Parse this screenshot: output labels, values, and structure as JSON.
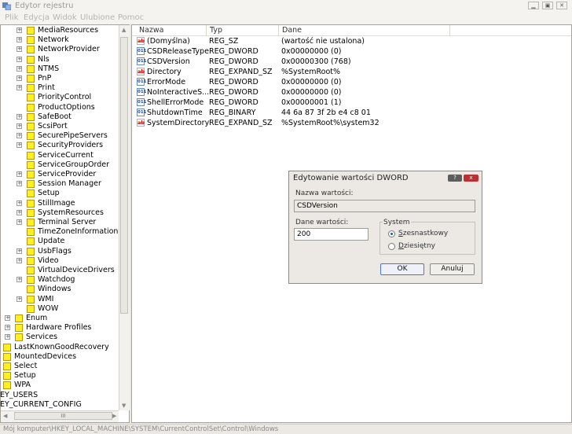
{
  "window": {
    "title": "Edytor rejestru"
  },
  "menu": {
    "items": [
      "Plik",
      "Edycja",
      "Widok",
      "Ulubione",
      "Pomoc"
    ]
  },
  "tree": {
    "items": [
      {
        "label": "MediaResources",
        "expander": "+",
        "folder": true
      },
      {
        "label": "Network",
        "expander": "+",
        "folder": true
      },
      {
        "label": "NetworkProvider",
        "expander": "+",
        "folder": true
      },
      {
        "label": "Nls",
        "expander": "+",
        "folder": true
      },
      {
        "label": "NTMS",
        "expander": "+",
        "folder": true
      },
      {
        "label": "PnP",
        "expander": "+",
        "folder": true
      },
      {
        "label": "Print",
        "expander": "+",
        "folder": true
      },
      {
        "label": "PriorityControl",
        "expander": "",
        "folder": true
      },
      {
        "label": "ProductOptions",
        "expander": "",
        "folder": true
      },
      {
        "label": "SafeBoot",
        "expander": "+",
        "folder": true
      },
      {
        "label": "ScsiPort",
        "expander": "+",
        "folder": true
      },
      {
        "label": "SecurePipeServers",
        "expander": "+",
        "folder": true
      },
      {
        "label": "SecurityProviders",
        "expander": "+",
        "folder": true
      },
      {
        "label": "ServiceCurrent",
        "expander": "",
        "folder": true
      },
      {
        "label": "ServiceGroupOrder",
        "expander": "",
        "folder": true
      },
      {
        "label": "ServiceProvider",
        "expander": "+",
        "folder": true
      },
      {
        "label": "Session Manager",
        "expander": "+",
        "folder": true
      },
      {
        "label": "Setup",
        "expander": "",
        "folder": true
      },
      {
        "label": "StillImage",
        "expander": "+",
        "folder": true
      },
      {
        "label": "SystemResources",
        "expander": "+",
        "folder": true
      },
      {
        "label": "Terminal Server",
        "expander": "+",
        "folder": true
      },
      {
        "label": "TimeZoneInformation",
        "expander": "",
        "folder": true
      },
      {
        "label": "Update",
        "expander": "",
        "folder": true
      },
      {
        "label": "UsbFlags",
        "expander": "+",
        "folder": true
      },
      {
        "label": "Video",
        "expander": "+",
        "folder": true
      },
      {
        "label": "VirtualDeviceDrivers",
        "expander": "",
        "folder": true
      },
      {
        "label": "Watchdog",
        "expander": "+",
        "folder": true
      },
      {
        "label": "Windows",
        "expander": "",
        "folder": true
      },
      {
        "label": "WMI",
        "expander": "+",
        "folder": true
      },
      {
        "label": "WOW",
        "expander": "",
        "folder": true
      },
      {
        "label": "Enum",
        "expander": "+",
        "folder": true
      },
      {
        "label": "Hardware Profiles",
        "expander": "+",
        "folder": true
      },
      {
        "label": "Services",
        "expander": "+",
        "folder": true
      },
      {
        "label": "LastKnownGoodRecovery",
        "expander": "",
        "folder": true
      },
      {
        "label": "MountedDevices",
        "expander": "",
        "folder": true
      },
      {
        "label": "Select",
        "expander": "",
        "folder": true
      },
      {
        "label": "Setup",
        "expander": "",
        "folder": true
      },
      {
        "label": "WPA",
        "expander": "",
        "folder": true
      },
      {
        "label": "EY_USERS",
        "expander": "",
        "folder": false
      },
      {
        "label": "EY_CURRENT_CONFIG",
        "expander": "",
        "folder": false
      }
    ],
    "hscroll_thumb_label": "III"
  },
  "list": {
    "columns": [
      "Nazwa",
      "Typ",
      "Dane"
    ],
    "rows": [
      {
        "icon": "string-value-icon",
        "name": "(Domyślna)",
        "type": "REG_SZ",
        "data": "(wartość nie ustalona)"
      },
      {
        "icon": "binary-value-icon",
        "name": "CSDReleaseType",
        "type": "REG_DWORD",
        "data": "0x00000000 (0)"
      },
      {
        "icon": "binary-value-icon",
        "name": "CSDVersion",
        "type": "REG_DWORD",
        "data": "0x00000300 (768)"
      },
      {
        "icon": "string-value-icon",
        "name": "Directory",
        "type": "REG_EXPAND_SZ",
        "data": "%SystemRoot%"
      },
      {
        "icon": "binary-value-icon",
        "name": "ErrorMode",
        "type": "REG_DWORD",
        "data": "0x00000000 (0)"
      },
      {
        "icon": "binary-value-icon",
        "name": "NoInteractiveS...",
        "type": "REG_DWORD",
        "data": "0x00000000 (0)"
      },
      {
        "icon": "binary-value-icon",
        "name": "ShellErrorMode",
        "type": "REG_DWORD",
        "data": "0x00000001 (1)"
      },
      {
        "icon": "binary-value-icon",
        "name": "ShutdownTime",
        "type": "REG_BINARY",
        "data": "44 6a 87 3f 2b e4 c8 01"
      },
      {
        "icon": "string-value-icon",
        "name": "SystemDirectory",
        "type": "REG_EXPAND_SZ",
        "data": "%SystemRoot%\\system32"
      }
    ]
  },
  "dialog": {
    "title": "Edytowanie wartości DWORD",
    "name_label": "Nazwa wartości:",
    "name_value": "CSDVersion",
    "data_label": "Dane wartości:",
    "data_value": "200",
    "base_label": "System",
    "radio_hex": "Szesnastkowy",
    "radio_dec": "Dziesiętny",
    "base_selected": "hex",
    "ok_label": "OK",
    "cancel_label": "Anuluj",
    "help_icon": "?",
    "close_icon": "x"
  },
  "status": {
    "path": "Mój komputer\\HKEY_LOCAL_MACHINE\\SYSTEM\\CurrentControlSet\\Control\\Windows"
  },
  "colors": {
    "folder": "#ffef24",
    "title_text": "#9b9b9b",
    "ok_border": "#4c78c4",
    "close_button": "#b73333"
  }
}
